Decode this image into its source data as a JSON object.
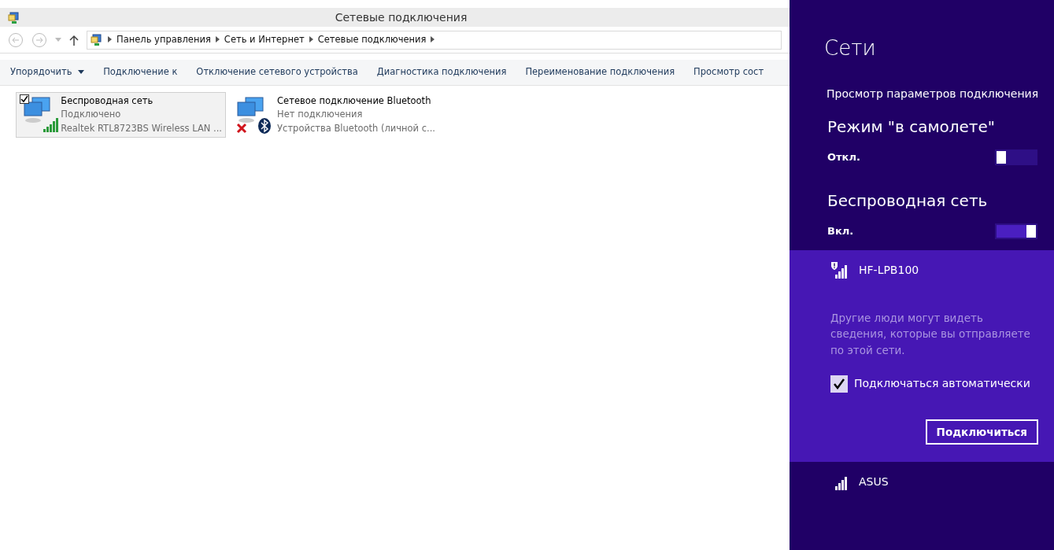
{
  "window": {
    "title": "Сетевые подключения"
  },
  "address_bar": {
    "breadcrumbs": [
      "Панель управления",
      "Сеть и Интернет",
      "Сетевые подключения"
    ]
  },
  "toolbar": [
    {
      "label": "Упорядочить",
      "kind": "menu"
    },
    {
      "label": "Подключение к",
      "kind": "button"
    },
    {
      "label": "Отключение сетевого устройства",
      "kind": "button"
    },
    {
      "label": "Диагностика подключения",
      "kind": "button"
    },
    {
      "label": "Переименование подключения",
      "kind": "button"
    },
    {
      "label": "Просмотр сост",
      "kind": "button"
    }
  ],
  "connections": [
    {
      "name": "Беспроводная сеть",
      "status": "Подключено",
      "device": "Realtek RTL8723BS Wireless LAN ...",
      "kind": "wifi",
      "connected": true,
      "selected": true
    },
    {
      "name": "Сетевое подключение Bluetooth",
      "status": "Нет подключения",
      "device": "Устройства Bluetooth (личной с...",
      "kind": "bluetooth",
      "connected": false,
      "selected": false
    }
  ],
  "networks_panel": {
    "title": "Сети",
    "settings_link": "Просмотр параметров подключения",
    "toggles": [
      {
        "title": "Режим \"в самолете\"",
        "state_label": "Откл.",
        "on": false
      },
      {
        "title": "Беспроводная сеть",
        "state_label": "Вкл.",
        "on": true
      }
    ],
    "networks": [
      {
        "name": "HF-LPB100",
        "secured": false,
        "expanded": true,
        "warning": "Другие люди могут видеть сведения, которые вы отправляете по этой сети.",
        "auto_connect": {
          "label": "Подключаться автоматически",
          "checked": true
        },
        "connect_button": "Подключиться"
      },
      {
        "name": "ASUS",
        "secured": true,
        "expanded": false
      }
    ]
  }
}
